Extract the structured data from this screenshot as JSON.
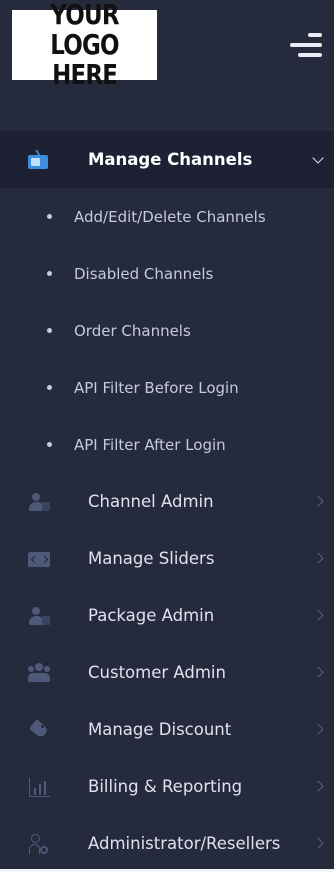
{
  "logo": {
    "line1": "YOUR LOGO",
    "line2": "HERE"
  },
  "menu": {
    "active": {
      "label": "Manage Channels",
      "icon": "tv-icon"
    },
    "subitems": [
      {
        "label": "Add/Edit/Delete Channels"
      },
      {
        "label": "Disabled Channels"
      },
      {
        "label": "Order Channels"
      },
      {
        "label": "API Filter Before Login"
      },
      {
        "label": "API Filter After Login"
      }
    ],
    "items": [
      {
        "label": "Channel Admin",
        "icon": "user-icon"
      },
      {
        "label": "Manage Sliders",
        "icon": "slider-icon"
      },
      {
        "label": "Package Admin",
        "icon": "user-icon"
      },
      {
        "label": "Customer Admin",
        "icon": "group-icon"
      },
      {
        "label": "Manage Discount",
        "icon": "tag-icon"
      },
      {
        "label": "Billing & Reporting",
        "icon": "chart-icon"
      },
      {
        "label": "Administrator/Resellers",
        "icon": "admin-icon"
      }
    ]
  },
  "colors": {
    "sidebar_bg": "#252a3d",
    "active_bg": "#1d2133",
    "text": "#dfe3ef",
    "accent": "#3d8fdd"
  }
}
